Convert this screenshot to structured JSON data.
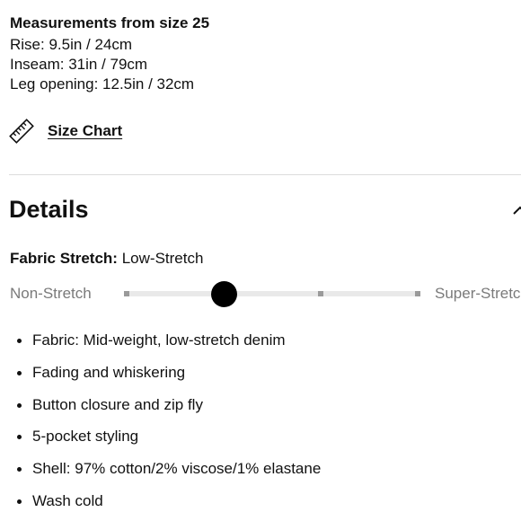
{
  "measurements": {
    "title": "Measurements from size 25",
    "lines": [
      "Rise: 9.5in / 24cm",
      "Inseam: 31in / 79cm",
      "Leg opening: 12.5in / 32cm"
    ]
  },
  "size_chart": {
    "icon": "ruler-icon",
    "label": "Size Chart"
  },
  "details": {
    "title": "Details",
    "toggle_icon": "chevron-up-icon",
    "fabric_stretch": {
      "label": "Fabric Stretch:",
      "value": "Low-Stretch",
      "scale_min_label": "Non-Stretch",
      "scale_max_label": "Super-Stretch",
      "levels": 4,
      "selected_level": 1
    },
    "bullets": [
      "Fabric: Mid-weight, low-stretch denim",
      "Fading and whiskering",
      "Button closure and zip fly",
      "5-pocket styling",
      "Shell: 97% cotton/2% viscose/1% elastane",
      "Wash cold"
    ]
  }
}
